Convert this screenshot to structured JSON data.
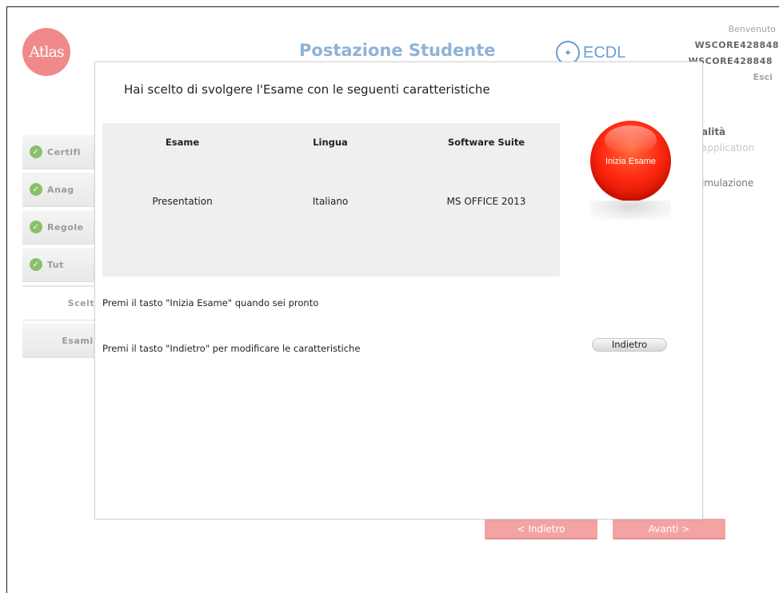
{
  "header": {
    "logo_text": "Atlas",
    "title": "Postazione Studente",
    "ecdl_label": "ECDL",
    "welcome": "Benvenuto",
    "user_id_1": "WSCORE428848",
    "user_id_2": "WSCORE428848",
    "exit_label": "Esci"
  },
  "sidebar": {
    "items": [
      {
        "label": "Certifi",
        "checked": true
      },
      {
        "label": "Anag",
        "checked": true
      },
      {
        "label": "Regole",
        "checked": true
      },
      {
        "label": "Tut",
        "checked": true
      },
      {
        "label": "Scelta",
        "checked": false,
        "active": true
      },
      {
        "label": "Esami s",
        "checked": false
      }
    ]
  },
  "right_panel": {
    "heading": "alità",
    "sub": "application",
    "item": "imulazione"
  },
  "footer": {
    "back_label": "< Indietro",
    "next_label": "Avanti >"
  },
  "modal": {
    "title": "Hai scelto di svolgere l'Esame con le seguenti caratteristiche",
    "columns": [
      {
        "header": "Esame",
        "value": "Presentation"
      },
      {
        "header": "Lingua",
        "value": "Italiano"
      },
      {
        "header": "Software Suite",
        "value": "MS OFFICE 2013"
      }
    ],
    "start_button": "Inizia Esame",
    "note_start": "Premi il tasto \"Inizia Esame\" quando sei pronto",
    "note_back": "Premi il tasto \"Indietro\" per modificare le caratteristiche",
    "back_button": "Indietro"
  },
  "colors": {
    "accent_red": "#ff2a12",
    "title_blue": "#8fb2d8",
    "ecdl_blue": "#6d9cd3",
    "nav_button": "#f4a3a3",
    "check_green": "#8bbf6a"
  }
}
